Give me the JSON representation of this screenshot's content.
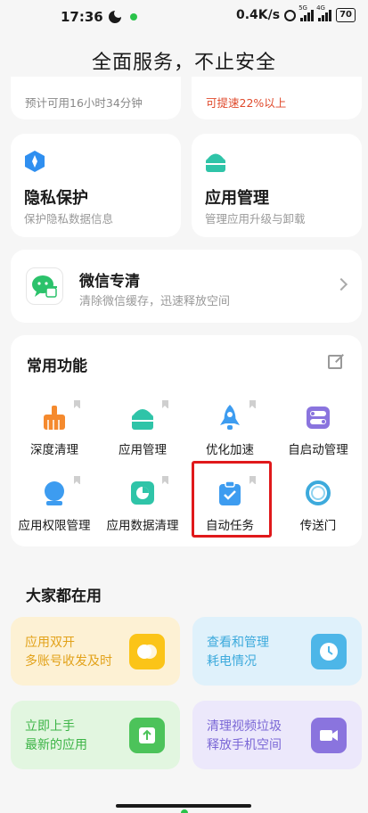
{
  "status_bar": {
    "time": "17:36",
    "network_speed": "0.4K/s",
    "signal1_label": "5G",
    "signal2_label": "4G",
    "battery": "70"
  },
  "page": {
    "title": "全面服务，不止安全"
  },
  "top_cards": {
    "left_sub": "预计可用16小时34分钟",
    "right_sub": "可提速22%以上"
  },
  "cards": [
    {
      "icon": "privacy-shield-icon",
      "title": "隐私保护",
      "sub": "保护隐私数据信息"
    },
    {
      "icon": "android-app-icon",
      "title": "应用管理",
      "sub": "管理应用升级与卸载"
    }
  ],
  "wechat": {
    "title": "微信专清",
    "sub": "清除微信缓存，迅速释放空间"
  },
  "common": {
    "title": "常用功能",
    "items": [
      {
        "label": "深度清理",
        "icon": "broom-icon"
      },
      {
        "label": "应用管理",
        "icon": "android-app-icon"
      },
      {
        "label": "优化加速",
        "icon": "rocket-icon"
      },
      {
        "label": "自启动管理",
        "icon": "toggle-icon"
      },
      {
        "label": "应用权限管理",
        "icon": "permission-icon"
      },
      {
        "label": "应用数据清理",
        "icon": "pie-chart-icon"
      },
      {
        "label": "自动任务",
        "icon": "clipboard-check-icon"
      },
      {
        "label": "传送门",
        "icon": "portal-ring-icon"
      }
    ]
  },
  "everyone_uses": {
    "title": "大家都在用",
    "items": [
      {
        "line1": "应用双开",
        "line2": "多账号收发及时",
        "icon": "dual-app-icon",
        "bg": "#fdf1d4",
        "fg": "#e2a21a"
      },
      {
        "line1": "查看和管理",
        "line2": "耗电情况",
        "icon": "clock-icon",
        "bg": "#dff1fb",
        "fg": "#3daadc"
      },
      {
        "line1": "立即上手",
        "line2": "最新的应用",
        "icon": "upload-icon",
        "bg": "#e2f6e0",
        "fg": "#3cb446"
      },
      {
        "line1": "清理视频垃圾",
        "line2": "释放手机空间",
        "icon": "video-icon",
        "bg": "#ece8fb",
        "fg": "#7a67d6"
      }
    ]
  },
  "colors": {
    "accent_red": "#e0191b",
    "background": "#f6f6f6"
  }
}
